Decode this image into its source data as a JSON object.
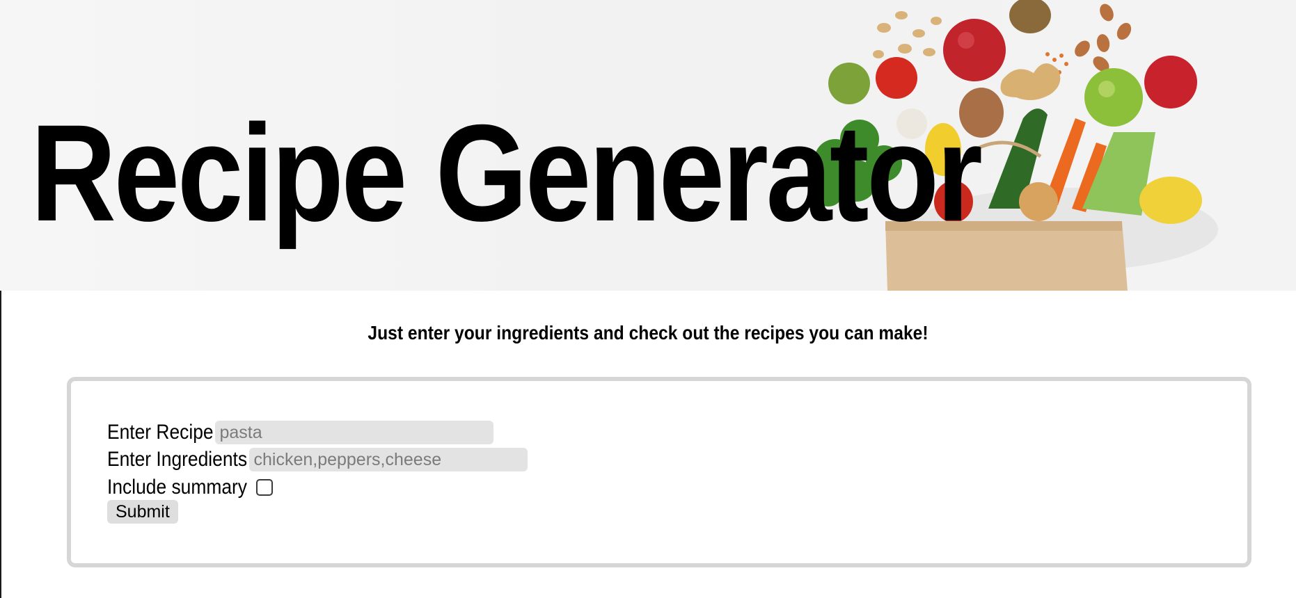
{
  "header": {
    "title": "Recipe Generator"
  },
  "tagline": "Just enter your ingredients and check out the recipes you can make!",
  "form": {
    "recipe": {
      "label": "Enter Recipe",
      "placeholder": "pasta",
      "value": ""
    },
    "ingredients": {
      "label": "Enter Ingredients",
      "placeholder": "chicken,peppers,cheese",
      "value": ""
    },
    "summary": {
      "label": "Include summary",
      "checked": false
    },
    "submit_label": "Submit"
  }
}
